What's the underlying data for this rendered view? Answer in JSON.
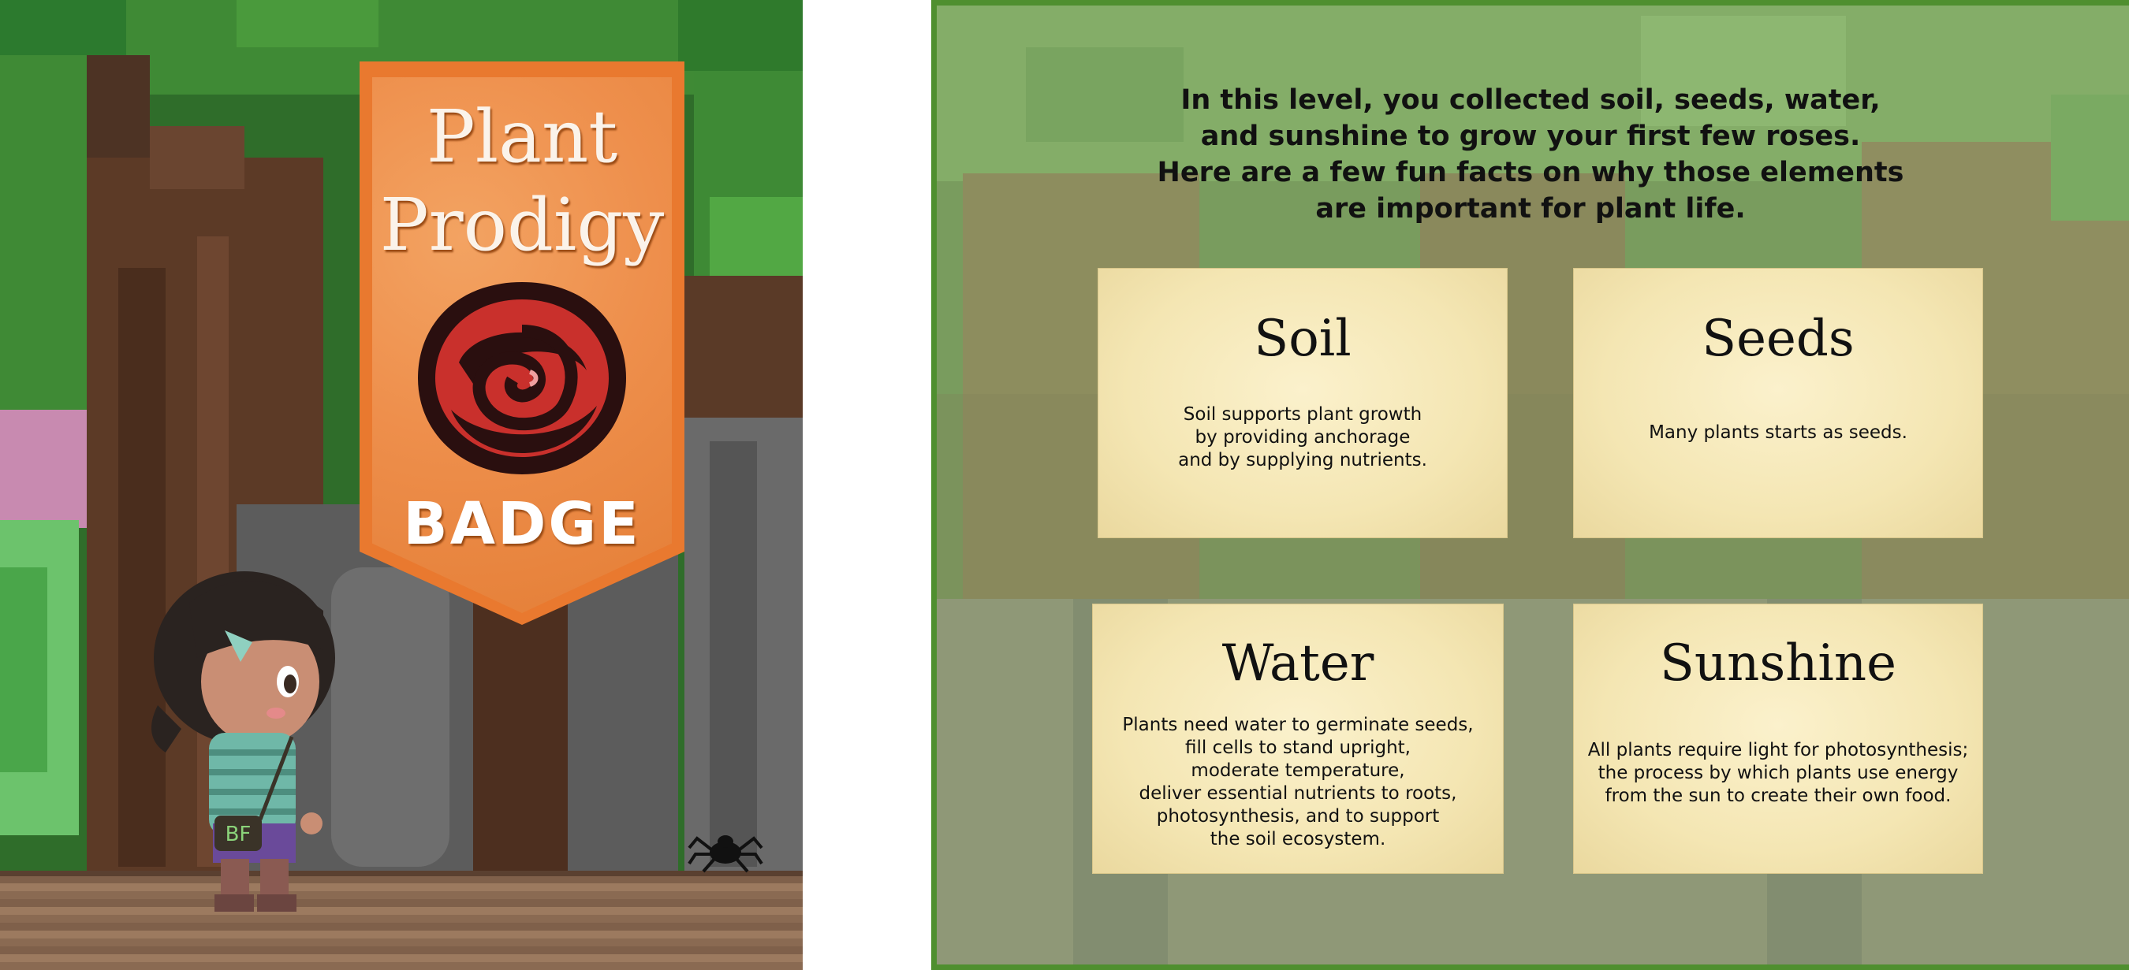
{
  "badge": {
    "title_line1": "Plant",
    "title_line2": "Prodigy",
    "subtitle": "BADGE",
    "icon": "rose-icon"
  },
  "character": {
    "bag_label": "BF"
  },
  "info": {
    "intro_lines": [
      "In this level, you collected soil, seeds, water,",
      "and sunshine to grow your first few roses.",
      "Here are a few fun facts on why those elements",
      "are important for plant life."
    ],
    "cards": [
      {
        "title": "Soil",
        "lines": [
          "Soil supports plant growth",
          "by providing anchorage",
          "and by supplying nutrients."
        ]
      },
      {
        "title": "Seeds",
        "lines": [
          "Many plants starts as seeds."
        ]
      },
      {
        "title": "Water",
        "lines": [
          "Plants need water to germinate seeds,",
          "fill cells to stand upright,",
          "moderate temperature,",
          "deliver essential nutrients to roots,",
          "photosynthesis, and to support",
          "the soil ecosystem."
        ]
      },
      {
        "title": "Sunshine",
        "lines": [
          "All plants require light for photosynthesis;",
          "the process by which plants use energy",
          "from the sun to create their own food."
        ]
      }
    ]
  },
  "colors": {
    "banner_orange": "#e9792f",
    "card_parchment": "#f4e6b3",
    "panel_border_green": "#4f8f2f"
  }
}
